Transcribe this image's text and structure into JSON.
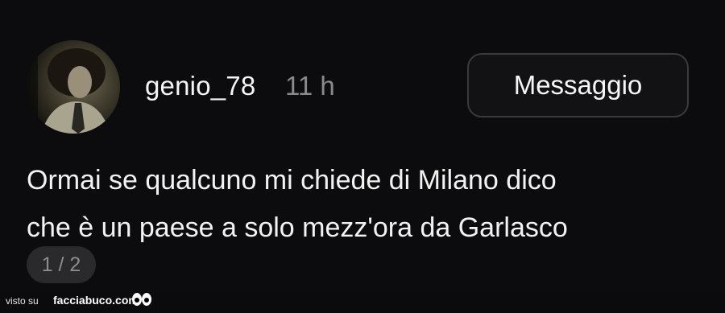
{
  "post": {
    "username": "genio_78",
    "time": "11 h",
    "message_button": "Messaggio",
    "text_line1": "Ormai se qualcuno mi chiede di Milano dico",
    "text_line2": "che è un paese a solo mezz'ora da Garlasco",
    "pager": "1 / 2"
  },
  "footer": {
    "seen_on": "visto su",
    "site": "facciabuco.com"
  },
  "icons": {
    "avatar": "user-avatar-photo",
    "watermark": "eyes-logo-icon"
  }
}
